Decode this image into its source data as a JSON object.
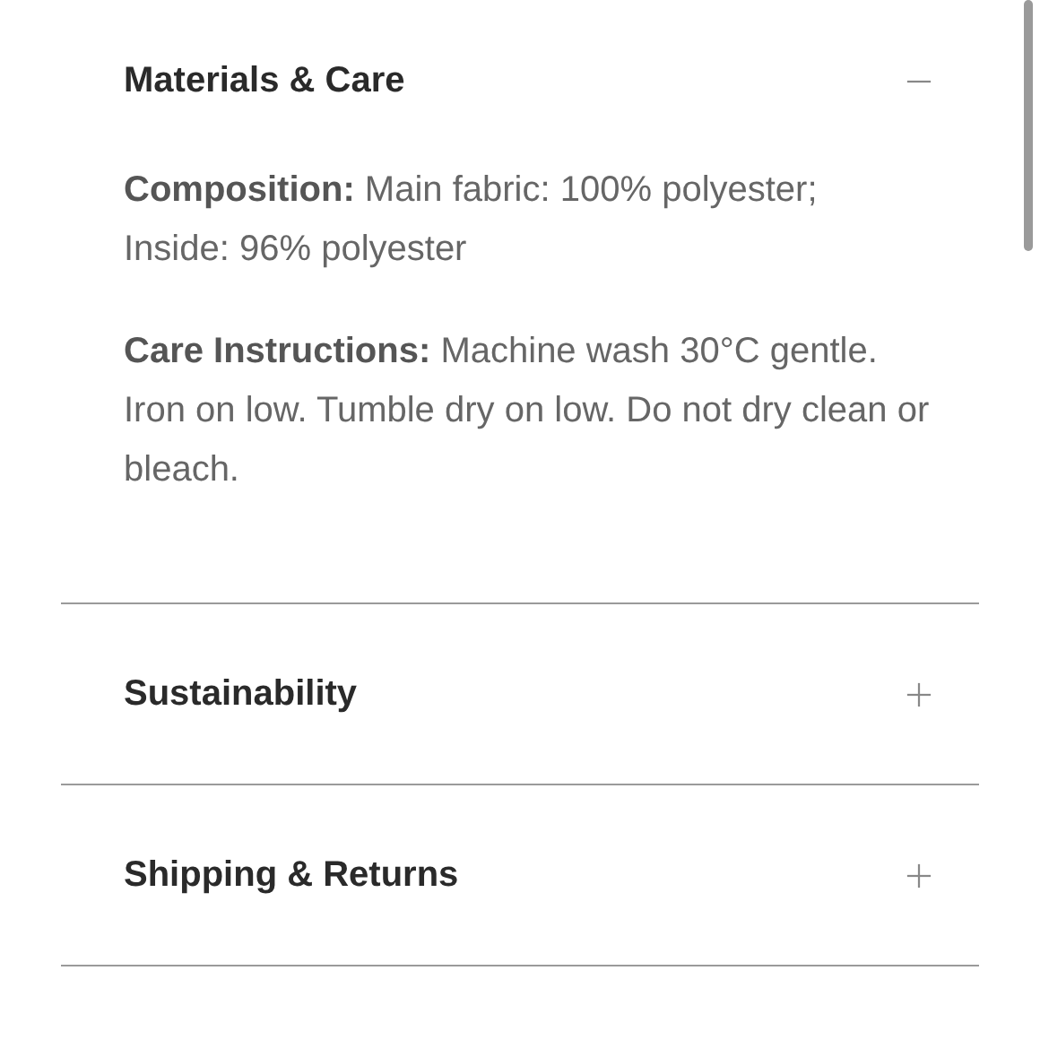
{
  "sections": [
    {
      "title": "Materials & Care",
      "expanded": true,
      "paragraphs": [
        "**Composition:** Main fabric: 100% polyester; Inside: 96% polyester",
        "**Care Instructions:** Machine wash 30°C gentle. Iron on low. Tumble dry on low. Do not dry clean or bleach."
      ]
    },
    {
      "title": "Sustainability",
      "expanded": false
    },
    {
      "title": "Shipping & Returns",
      "expanded": false
    }
  ]
}
